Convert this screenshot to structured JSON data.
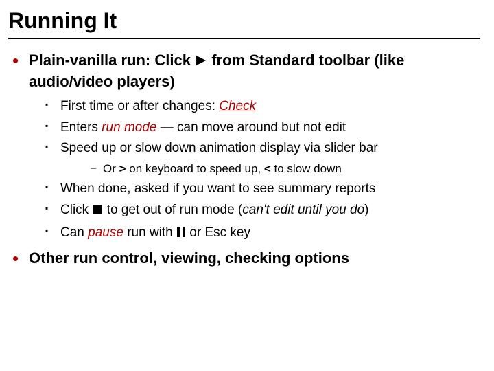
{
  "title": "Running It",
  "bullets": [
    {
      "headline_pre": "Plain-vanilla run:  Click ",
      "headline_post": " from Standard toolbar (like audio/video players)",
      "sub": [
        {
          "pre": "First time or after changes:  ",
          "em": "Check",
          "post": ""
        },
        {
          "pre": "Enters ",
          "em": "run mode",
          "post": " — can move around but not edit"
        },
        {
          "pre": "Speed up or slow down animation display via slider bar",
          "subsub": [
            {
              "text_pre": "Or ",
              "key1": ">",
              "mid": " on keyboard to speed up, ",
              "key2": "<",
              "post": " to slow down"
            }
          ]
        },
        {
          "pre": "When done, asked if you want to see summary reports"
        },
        {
          "pre": "Click ",
          "icon": "stop",
          "post_pre": " to get out of run mode (",
          "em": "can't edit until you do",
          "post_post": ")"
        },
        {
          "pre": "Can ",
          "em": "pause",
          "post_pre": " run with ",
          "icon": "pause",
          "post_post": " or Esc key"
        }
      ]
    },
    {
      "headline_pre": "Other run control, viewing, checking options"
    }
  ]
}
